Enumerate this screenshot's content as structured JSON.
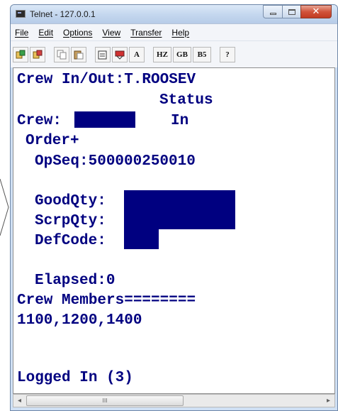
{
  "window": {
    "title": "Telnet - 127.0.0.1",
    "minimize_glyph": "",
    "close_glyph": "✕"
  },
  "menu": [
    "File",
    "Edit",
    "Options",
    "View",
    "Transfer",
    "Help"
  ],
  "toolbar": {
    "buttons": [
      {
        "icon": "connect-icon"
      },
      {
        "icon": "disconnect-icon"
      },
      {
        "icon": "copy-icon"
      },
      {
        "icon": "paste-icon"
      },
      {
        "icon": "properties-icon"
      },
      {
        "icon": "keyboard-icon"
      },
      {
        "icon": "font-icon",
        "label": "A"
      },
      {
        "icon": "hz-encoding-icon",
        "label": "HZ"
      },
      {
        "icon": "gb-encoding-icon",
        "label": "GB"
      },
      {
        "icon": "b5-encoding-icon",
        "label": "B5"
      },
      {
        "icon": "help-icon",
        "label": "?"
      }
    ]
  },
  "terminal": {
    "header": "Crew In/Out:T.ROOSEV",
    "status_header": "Status",
    "crew_label": "Crew:",
    "crew_status": "In",
    "order_label": "Order+",
    "opseq": "OpSeq:500000250010",
    "good_qty_label": "GoodQty:",
    "scrp_qty_label": "ScrpQty:",
    "def_code_label": "DefCode:",
    "elapsed": "Elapsed:0",
    "crew_members": "Crew Members========",
    "crew_ids": "1100,1200,1400",
    "logged_in": "Logged In (3)",
    "text_color": "#000080",
    "redaction_color": "#000080"
  },
  "scrollbar": {
    "left_arrow": "◂",
    "right_arrow": "▸",
    "thumb_grip": "III"
  },
  "colors": {
    "titlebar": "#c3d6ee",
    "close_button": "#c13a22",
    "terminal_bg": "#ffffff"
  }
}
